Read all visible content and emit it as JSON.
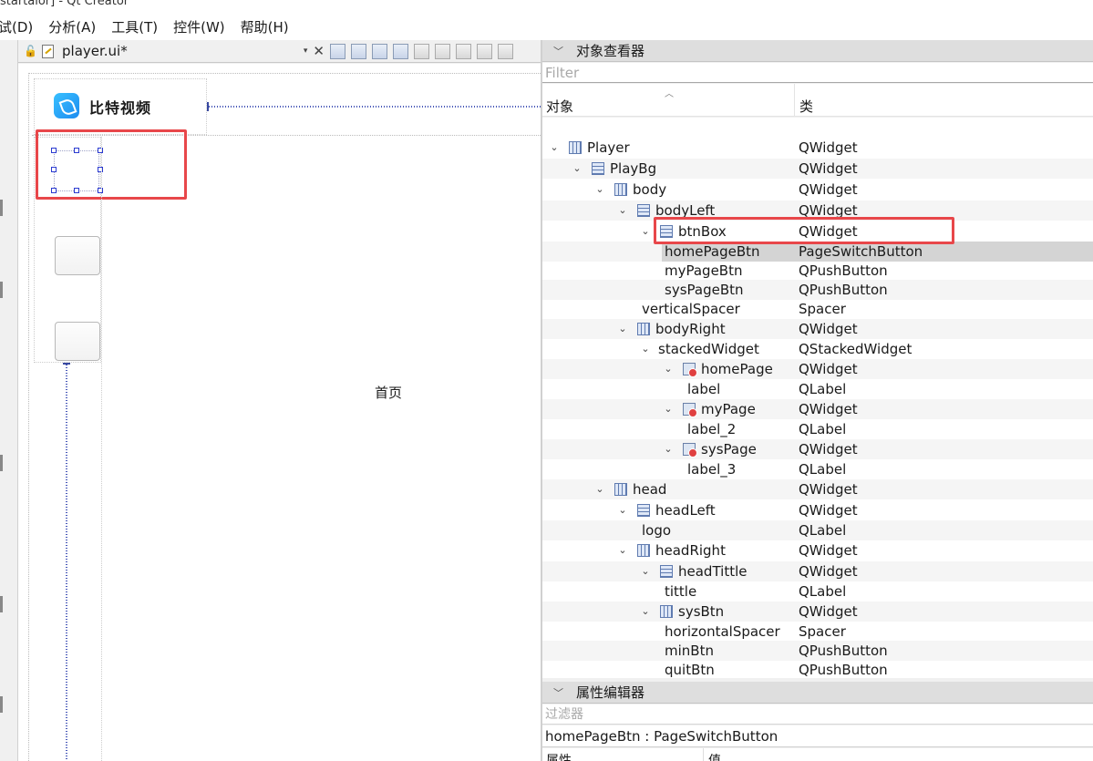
{
  "window": {
    "title_fragment": "startalor] - Qt Creator"
  },
  "menu": [
    "试(D)",
    "分析(A)",
    "工具(T)",
    "控件(W)",
    "帮助(H)"
  ],
  "editor": {
    "filename": "player.ui*",
    "dropdown": "▾",
    "close": "✕"
  },
  "form": {
    "logo_text": "比特视频",
    "page_label": "首页"
  },
  "object_inspector": {
    "title": "对象查看器",
    "filter_placeholder": "Filter",
    "col_object": "对象",
    "col_class": "类",
    "rows": [
      {
        "name": "Player",
        "cls": "QWidget",
        "depth": 0,
        "arrow": true,
        "icon": "hbox"
      },
      {
        "name": "PlayBg",
        "cls": "QWidget",
        "depth": 1,
        "arrow": true,
        "icon": "vbox"
      },
      {
        "name": "body",
        "cls": "QWidget",
        "depth": 2,
        "arrow": true,
        "icon": "hbox"
      },
      {
        "name": "bodyLeft",
        "cls": "QWidget",
        "depth": 3,
        "arrow": true,
        "icon": "vbox"
      },
      {
        "name": "btnBox",
        "cls": "QWidget",
        "depth": 4,
        "arrow": true,
        "icon": "vbox"
      },
      {
        "name": "homePageBtn",
        "cls": "PageSwitchButton",
        "depth": 5,
        "arrow": false,
        "icon": "",
        "selected": true
      },
      {
        "name": "myPageBtn",
        "cls": "QPushButton",
        "depth": 5,
        "arrow": false,
        "icon": ""
      },
      {
        "name": "sysPageBtn",
        "cls": "QPushButton",
        "depth": 5,
        "arrow": false,
        "icon": ""
      },
      {
        "name": "verticalSpacer",
        "cls": "Spacer",
        "depth": 4,
        "arrow": false,
        "icon": ""
      },
      {
        "name": "bodyRight",
        "cls": "QWidget",
        "depth": 3,
        "arrow": true,
        "icon": "hbox"
      },
      {
        "name": "stackedWidget",
        "cls": "QStackedWidget",
        "depth": 4,
        "arrow": true,
        "icon": ""
      },
      {
        "name": "homePage",
        "cls": "QWidget",
        "depth": 5,
        "arrow": true,
        "icon": "page"
      },
      {
        "name": "label",
        "cls": "QLabel",
        "depth": 6,
        "arrow": false,
        "icon": ""
      },
      {
        "name": "myPage",
        "cls": "QWidget",
        "depth": 5,
        "arrow": true,
        "icon": "page"
      },
      {
        "name": "label_2",
        "cls": "QLabel",
        "depth": 6,
        "arrow": false,
        "icon": ""
      },
      {
        "name": "sysPage",
        "cls": "QWidget",
        "depth": 5,
        "arrow": true,
        "icon": "page"
      },
      {
        "name": "label_3",
        "cls": "QLabel",
        "depth": 6,
        "arrow": false,
        "icon": ""
      },
      {
        "name": "head",
        "cls": "QWidget",
        "depth": 2,
        "arrow": true,
        "icon": "hbox"
      },
      {
        "name": "headLeft",
        "cls": "QWidget",
        "depth": 3,
        "arrow": true,
        "icon": "vbox"
      },
      {
        "name": "logo",
        "cls": "QLabel",
        "depth": 4,
        "arrow": false,
        "icon": ""
      },
      {
        "name": "headRight",
        "cls": "QWidget",
        "depth": 3,
        "arrow": true,
        "icon": "hbox"
      },
      {
        "name": "headTittle",
        "cls": "QWidget",
        "depth": 4,
        "arrow": true,
        "icon": "vbox"
      },
      {
        "name": "tittle",
        "cls": "QLabel",
        "depth": 5,
        "arrow": false,
        "icon": ""
      },
      {
        "name": "sysBtn",
        "cls": "QWidget",
        "depth": 4,
        "arrow": true,
        "icon": "hbox"
      },
      {
        "name": "horizontalSpacer",
        "cls": "Spacer",
        "depth": 5,
        "arrow": false,
        "icon": ""
      },
      {
        "name": "minBtn",
        "cls": "QPushButton",
        "depth": 5,
        "arrow": false,
        "icon": ""
      },
      {
        "name": "quitBtn",
        "cls": "QPushButton",
        "depth": 5,
        "arrow": false,
        "icon": ""
      }
    ]
  },
  "property_editor": {
    "title": "属性编辑器",
    "filter_placeholder": "过滤器",
    "object_line": "homePageBtn : PageSwitchButton",
    "col_property": "属性",
    "col_value": "值"
  },
  "colors": {
    "highlight": "#e8474a",
    "selection": "#d4d4d4"
  }
}
